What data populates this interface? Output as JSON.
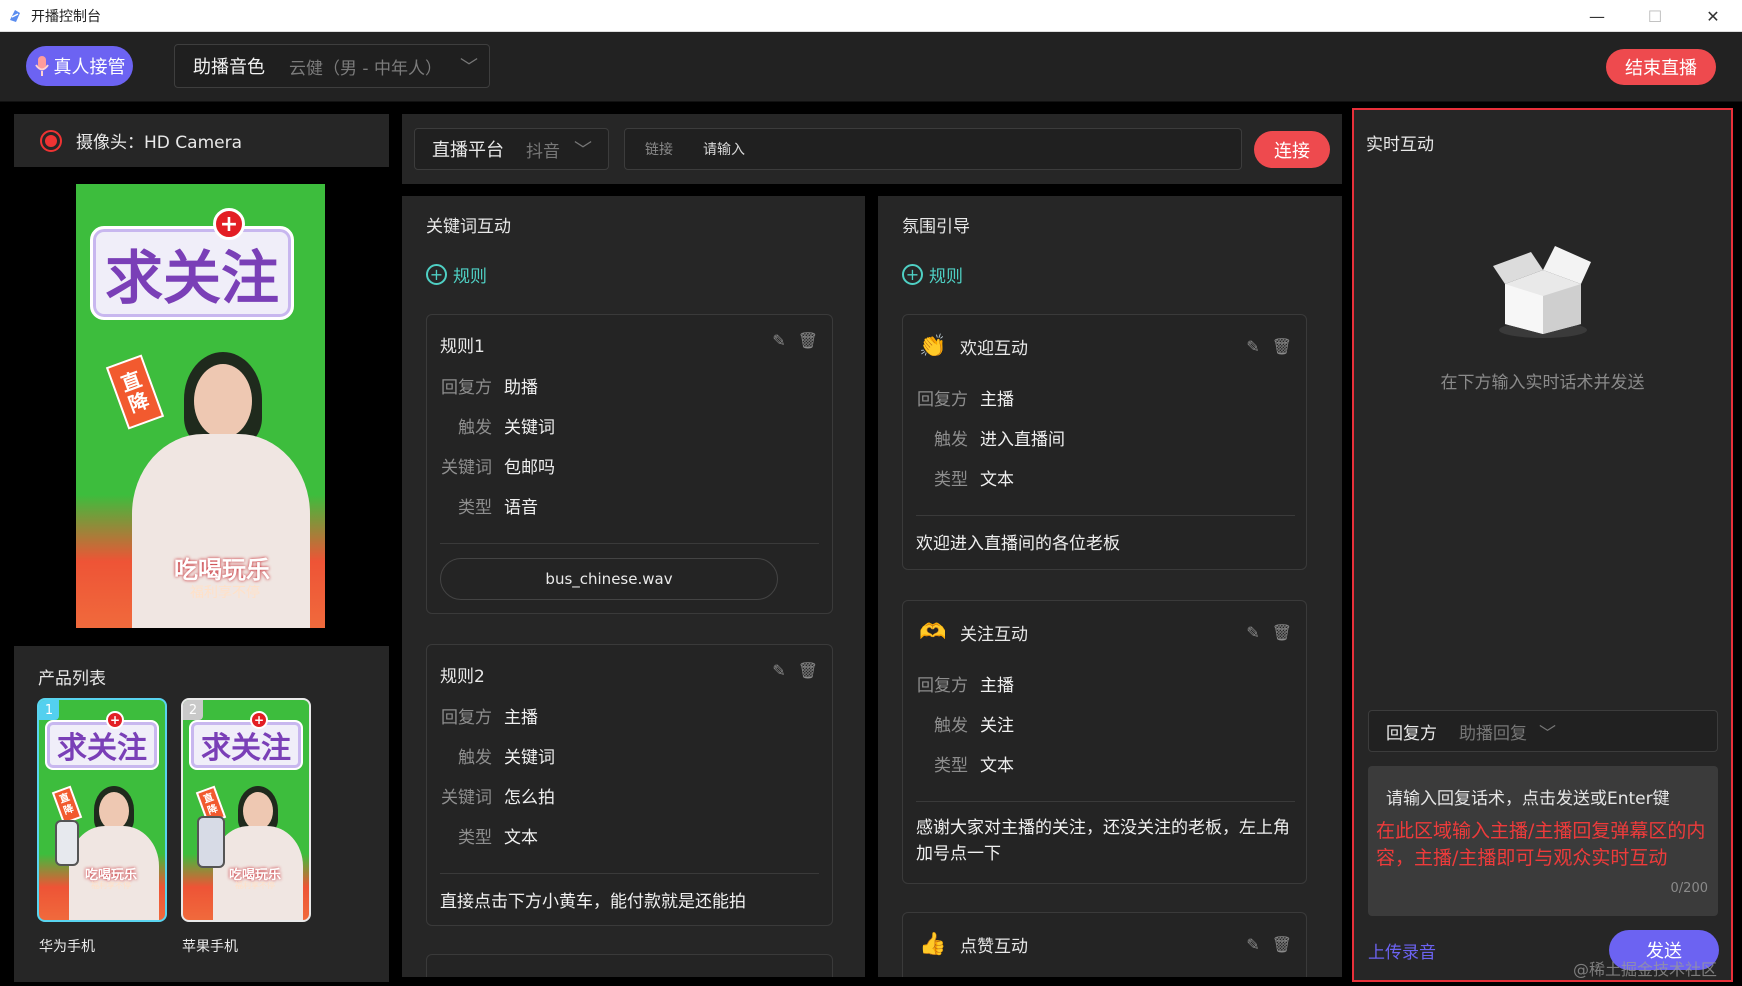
{
  "window": {
    "title": "开播控制台"
  },
  "topbar": {
    "takeover_label": "真人接管",
    "voice_label": "助播音色",
    "voice_value": "云健（男 - 中年人）",
    "end_label": "结束直播"
  },
  "camera": {
    "label": "摄像头：HD Camera"
  },
  "poster": {
    "badge": "求关注",
    "plus": "+",
    "down": "直降",
    "slogan": "吃喝玩乐",
    "sub": "福利享不停"
  },
  "products": {
    "header": "产品列表",
    "items": [
      {
        "num": "1",
        "name": "华为手机"
      },
      {
        "num": "2",
        "name": "苹果手机"
      }
    ]
  },
  "platform": {
    "label": "直播平台",
    "value": "抖音",
    "link_label": "链接",
    "link_placeholder": "请输入",
    "connect_label": "连接"
  },
  "keyword": {
    "header": "关键词互动",
    "add_label": "规则",
    "rules": [
      {
        "title": "规则1",
        "reply_k": "回复方",
        "reply_v": "助播",
        "trigger_k": "触发",
        "trigger_v": "关键词",
        "kw_k": "关键词",
        "kw_v": "包邮吗",
        "type_k": "类型",
        "type_v": "语音",
        "audio": "bus_chinese.wav"
      },
      {
        "title": "规则2",
        "reply_k": "回复方",
        "reply_v": "主播",
        "trigger_k": "触发",
        "trigger_v": "关键词",
        "kw_k": "关键词",
        "kw_v": "怎么拍",
        "type_k": "类型",
        "type_v": "文本",
        "text": "直接点击下方小黄车，能付款就是还能拍"
      }
    ]
  },
  "atmosphere": {
    "header": "氛围引导",
    "add_label": "规则",
    "rules": [
      {
        "title": "欢迎互动",
        "icon": "clap-icon",
        "reply_k": "回复方",
        "reply_v": "主播",
        "trigger_k": "触发",
        "trigger_v": "进入直播间",
        "type_k": "类型",
        "type_v": "文本",
        "text": "欢迎进入直播间的各位老板"
      },
      {
        "title": "关注互动",
        "icon": "heart-hand-icon",
        "reply_k": "回复方",
        "reply_v": "主播",
        "trigger_k": "触发",
        "trigger_v": "关注",
        "type_k": "类型",
        "type_v": "文本",
        "text": "感谢大家对主播的关注，还没关注的老板，左上角加号点一下"
      },
      {
        "title": "点赞互动",
        "icon": "thumbs-up-icon"
      }
    ]
  },
  "realtime": {
    "header": "实时互动",
    "empty_text": "在下方输入实时话术并发送",
    "reply_label": "回复方",
    "reply_value": "助播回复",
    "placeholder": "请输入回复话术，点击发送或Enter键",
    "note": "在此区域输入主播/主播回复弹幕区的内容，主播/主播即可与观众实时互动",
    "count": "0/200",
    "upload_label": "上传录音",
    "send_label": "发送"
  },
  "watermark": "@稀土掘金技术社区",
  "colors": {
    "accent": "#6c63f2",
    "danger": "#ee4a4e",
    "teal": "#4fd0c4",
    "highlight_border": "#e8303a"
  }
}
